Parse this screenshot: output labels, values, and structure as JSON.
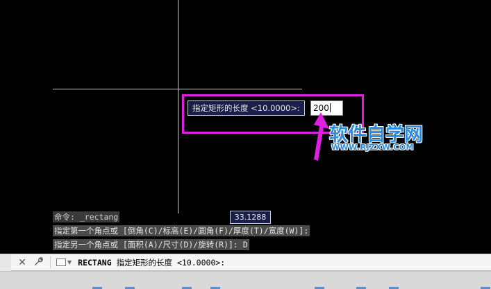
{
  "dynamic_prompt": {
    "label": "指定矩形的长度 <10.0000>:",
    "input_value": "200"
  },
  "coordinate_tooltip": "33.1288",
  "watermark": {
    "title": "软件自学网",
    "url": "WWW.RJZXW.COM"
  },
  "command_history": [
    "命令: _rectang",
    "指定第一个角点或 [倒角(C)/标高(E)/圆角(F)/厚度(T)/宽度(W)]:",
    "指定另一个角点或 [面积(A)/尺寸(D)/旋转(R)]: D"
  ],
  "command_line": {
    "command": "RECTANG",
    "prompt": "指定矩形的长度 <10.0000>:"
  },
  "colors": {
    "highlight": "#e020e0",
    "tooltip_bg": "#1a1f4a",
    "watermark": "#2a8be0"
  }
}
